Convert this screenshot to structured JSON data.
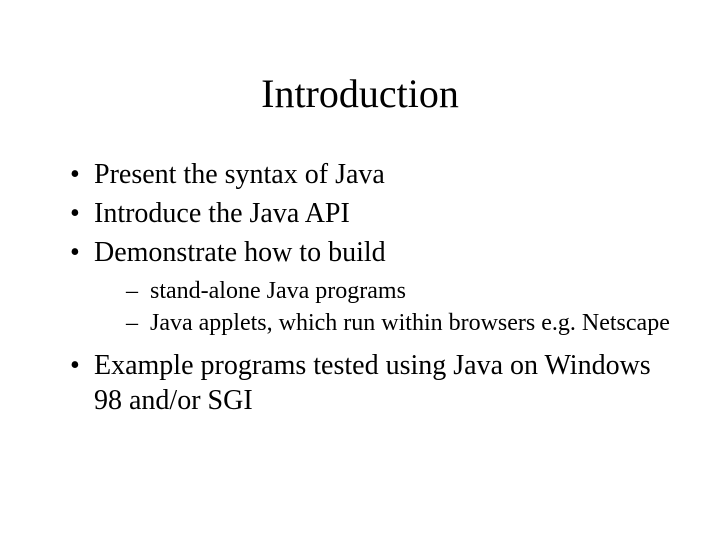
{
  "title": "Introduction",
  "bullets": [
    {
      "text": "Present the syntax of Java"
    },
    {
      "text": "Introduce the Java API"
    },
    {
      "text": "Demonstrate how to build",
      "sub": [
        "stand-alone Java programs",
        "Java applets, which run within browsers e.g. Netscape"
      ]
    },
    {
      "text": "Example programs tested using Java on Windows 98 and/or SGI"
    }
  ]
}
